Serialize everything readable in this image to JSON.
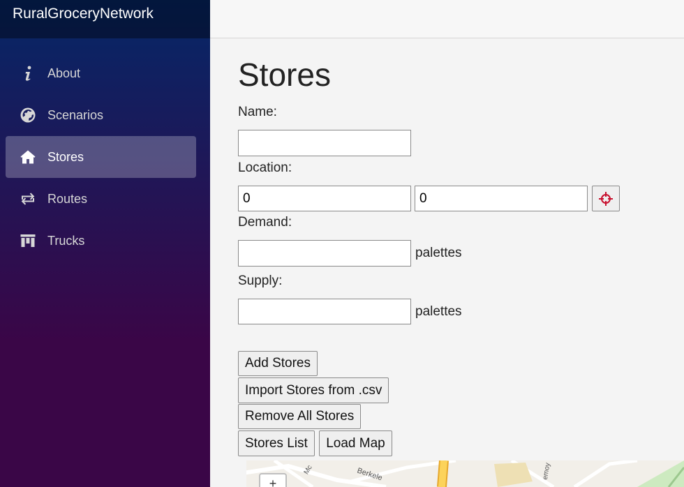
{
  "app": {
    "title": "RuralGroceryNetwork"
  },
  "sidebar": {
    "items": [
      {
        "label": "About",
        "icon": "info-icon",
        "active": false
      },
      {
        "label": "Scenarios",
        "icon": "globe-icon",
        "active": false
      },
      {
        "label": "Stores",
        "icon": "home-icon",
        "active": true
      },
      {
        "label": "Routes",
        "icon": "swap-arrows-icon",
        "active": false
      },
      {
        "label": "Trucks",
        "icon": "columns-icon",
        "active": false
      }
    ]
  },
  "main": {
    "title": "Stores",
    "form": {
      "name_label": "Name:",
      "name_value": "",
      "location_label": "Location:",
      "location_x": "0",
      "location_y": "0",
      "demand_label": "Demand:",
      "demand_value": "",
      "demand_unit": "palettes",
      "supply_label": "Supply:",
      "supply_value": "",
      "supply_unit": "palettes"
    },
    "buttons": {
      "add": "Add Stores",
      "import": "Import Stores from .csv",
      "remove_all": "Remove All Stores",
      "list": "Stores List",
      "load_map": "Load Map"
    },
    "map": {
      "street_1": "Mc",
      "street_2": "Berkele",
      "street_3": "emoy",
      "zoom_in": "+"
    }
  },
  "colors": {
    "sidebar_top": "#052767",
    "sidebar_bottom": "#3a0647",
    "crosshair": "#c8102e"
  }
}
